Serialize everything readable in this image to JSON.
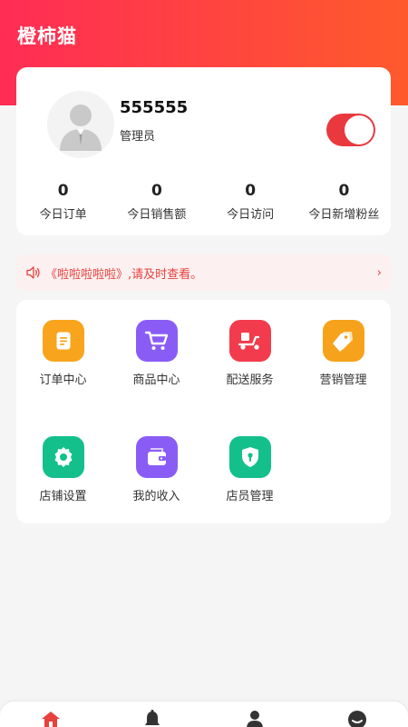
{
  "header": {
    "title": "橙柿猫"
  },
  "profile": {
    "name": "555555",
    "role": "管理员",
    "status_on": true
  },
  "stats": [
    {
      "value": "0",
      "label": "今日订单"
    },
    {
      "value": "0",
      "label": "今日销售额"
    },
    {
      "value": "0",
      "label": "今日访问"
    },
    {
      "value": "0",
      "label": "今日新增粉丝"
    }
  ],
  "notice": {
    "text": "《啦啦啦啦啦》,请及时查看。",
    "arrow": "›"
  },
  "menu": [
    {
      "label": "订单中心",
      "icon": "order-document-icon",
      "color": "#f8a51d"
    },
    {
      "label": "商品中心",
      "icon": "shopping-cart-icon",
      "color": "#8a5cf6"
    },
    {
      "label": "配送服务",
      "icon": "delivery-scooter-icon",
      "color": "#f23b4c"
    },
    {
      "label": "营销管理",
      "icon": "price-tag-icon",
      "color": "#f7a21b"
    },
    {
      "label": "店铺设置",
      "icon": "gear-icon",
      "color": "#13c08c"
    },
    {
      "label": "我的收入",
      "icon": "wallet-icon",
      "color": "#8a5cf6"
    },
    {
      "label": "店员管理",
      "icon": "shield-lock-icon",
      "color": "#13c08c"
    }
  ],
  "tabbar": {
    "items": [
      "home-icon",
      "bell-icon",
      "user-icon",
      "smile-icon"
    ],
    "active_color": "#e8413d",
    "inactive_color": "#333333"
  },
  "colors": {
    "brand_start": "#ff2c55",
    "brand_end": "#ff5a2c",
    "accent": "#e8413d"
  }
}
